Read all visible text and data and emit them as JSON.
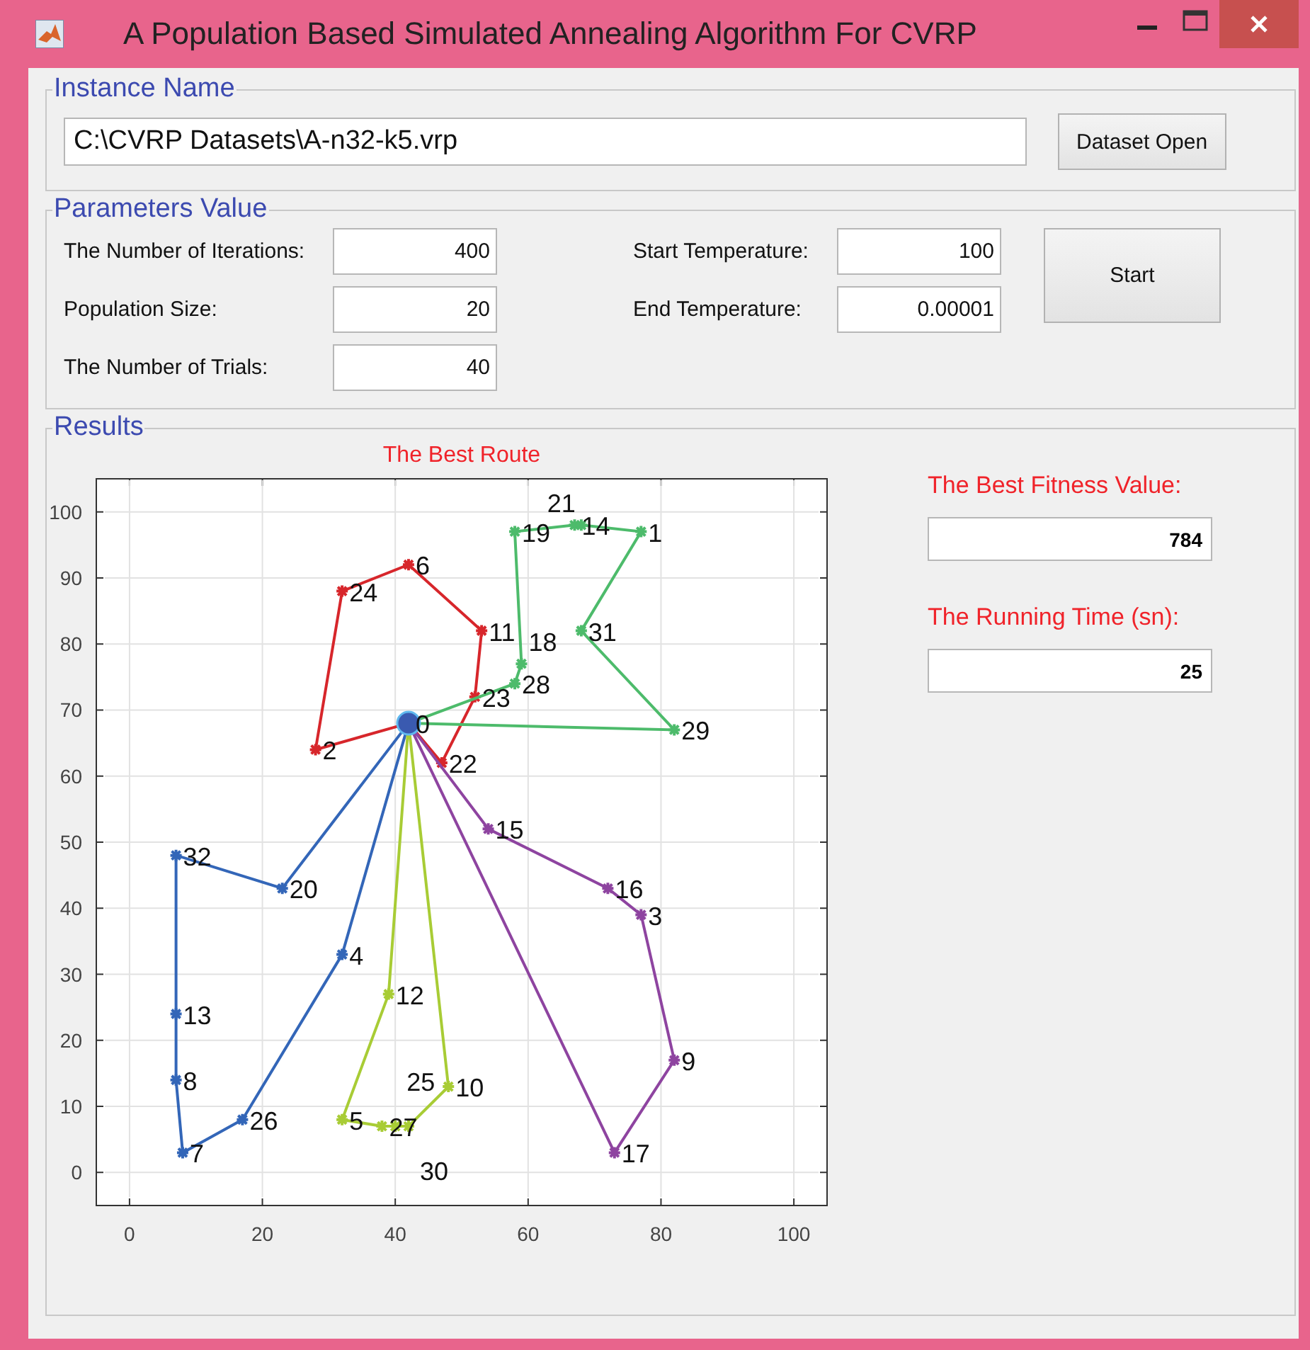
{
  "window": {
    "title": "A Population Based Simulated Annealing Algorithm For CVRP"
  },
  "instance": {
    "title": "Instance Name",
    "path": "C:\\CVRP Datasets\\A-n32-k5.vrp",
    "button": "Dataset Open"
  },
  "parameters": {
    "title": "Parameters Value",
    "button": "Start",
    "fields": [
      {
        "label": "The Number of Iterations:",
        "value": "400"
      },
      {
        "label": "Start Temperature:",
        "value": "100"
      },
      {
        "label": "Population Size:",
        "value": "20"
      },
      {
        "label": "End Temperature:",
        "value": "0.00001"
      },
      {
        "label": "The Number of Trials:",
        "value": "40"
      }
    ]
  },
  "results": {
    "title": "Results",
    "outputs": [
      {
        "label": "The Best Fitness Value:",
        "value": "784"
      },
      {
        "label": "The Running Time (sn):",
        "value": "25"
      }
    ],
    "chart_data": {
      "type": "scatter",
      "title": "The Best Route",
      "grid": true,
      "xlim": [
        -5,
        105
      ],
      "ylim": [
        -5,
        105
      ],
      "xticks": [
        0,
        20,
        40,
        60,
        80,
        100
      ],
      "yticks": [
        0,
        10,
        20,
        30,
        40,
        50,
        60,
        70,
        80,
        90,
        100
      ],
      "series": [
        {
          "color": "#d7262b",
          "marker": "cross",
          "x": [
            28,
            32,
            42,
            53,
            52,
            47
          ],
          "values": [
            64,
            88,
            92,
            82,
            72,
            62
          ]
        },
        {
          "color": "#4dbb6b",
          "marker": "cross",
          "x": [
            58,
            59,
            58,
            67,
            68,
            77,
            68,
            82
          ],
          "values": [
            74,
            77,
            97,
            98,
            98,
            97,
            82,
            67
          ]
        },
        {
          "color": "#3366b8",
          "marker": "cross",
          "x": [
            23,
            7,
            7,
            7,
            8,
            17,
            32
          ],
          "values": [
            43,
            48,
            24,
            14,
            3,
            8,
            33
          ]
        },
        {
          "color": "#a8cc35",
          "marker": "cross",
          "x": [
            39,
            32,
            38,
            40,
            42,
            48
          ],
          "values": [
            27,
            8,
            7,
            7,
            7,
            13
          ]
        },
        {
          "color": "#8e44a0",
          "marker": "cross",
          "x": [
            54,
            72,
            77,
            82,
            73
          ],
          "values": [
            52,
            43,
            39,
            17,
            3
          ]
        },
        {
          "color": "#3a5ab0",
          "marker": "circle",
          "x": [
            42
          ],
          "values": [
            68
          ]
        }
      ],
      "annotations": [
        {
          "x": 42,
          "y": 68,
          "text": "0"
        },
        {
          "x": 28,
          "y": 64,
          "text": "2"
        },
        {
          "x": 32,
          "y": 88,
          "text": "24"
        },
        {
          "x": 42,
          "y": 92,
          "text": "6"
        },
        {
          "x": 53,
          "y": 82,
          "text": "11"
        },
        {
          "x": 52,
          "y": 72,
          "text": "23"
        },
        {
          "x": 47,
          "y": 62,
          "text": "22"
        },
        {
          "x": 58,
          "y": 74,
          "text": "28"
        },
        {
          "x": 59,
          "y": 77,
          "text": "18"
        },
        {
          "x": 58,
          "y": 97,
          "text": "19"
        },
        {
          "x": 67,
          "y": 98,
          "text": "14"
        },
        {
          "x": 68,
          "y": 98,
          "text": "21"
        },
        {
          "x": 77,
          "y": 97,
          "text": "1"
        },
        {
          "x": 68,
          "y": 82,
          "text": "31"
        },
        {
          "x": 82,
          "y": 67,
          "text": "29"
        },
        {
          "x": 23,
          "y": 43,
          "text": "20"
        },
        {
          "x": 7,
          "y": 48,
          "text": "32"
        },
        {
          "x": 7,
          "y": 24,
          "text": "13"
        },
        {
          "x": 7,
          "y": 14,
          "text": "8"
        },
        {
          "x": 8,
          "y": 3,
          "text": "7"
        },
        {
          "x": 17,
          "y": 8,
          "text": "26"
        },
        {
          "x": 32,
          "y": 33,
          "text": "4"
        },
        {
          "x": 39,
          "y": 27,
          "text": "12"
        },
        {
          "x": 32,
          "y": 8,
          "text": "5"
        },
        {
          "x": 38,
          "y": 7,
          "text": "27"
        },
        {
          "x": 40,
          "y": 7,
          "text": "25"
        },
        {
          "x": 42,
          "y": 7,
          "text": "30"
        },
        {
          "x": 48,
          "y": 13,
          "text": "10"
        },
        {
          "x": 54,
          "y": 52,
          "text": "15"
        },
        {
          "x": 72,
          "y": 43,
          "text": "16"
        },
        {
          "x": 77,
          "y": 39,
          "text": "3"
        },
        {
          "x": 82,
          "y": 17,
          "text": "9"
        },
        {
          "x": 73,
          "y": 3,
          "text": "17"
        }
      ]
    }
  }
}
